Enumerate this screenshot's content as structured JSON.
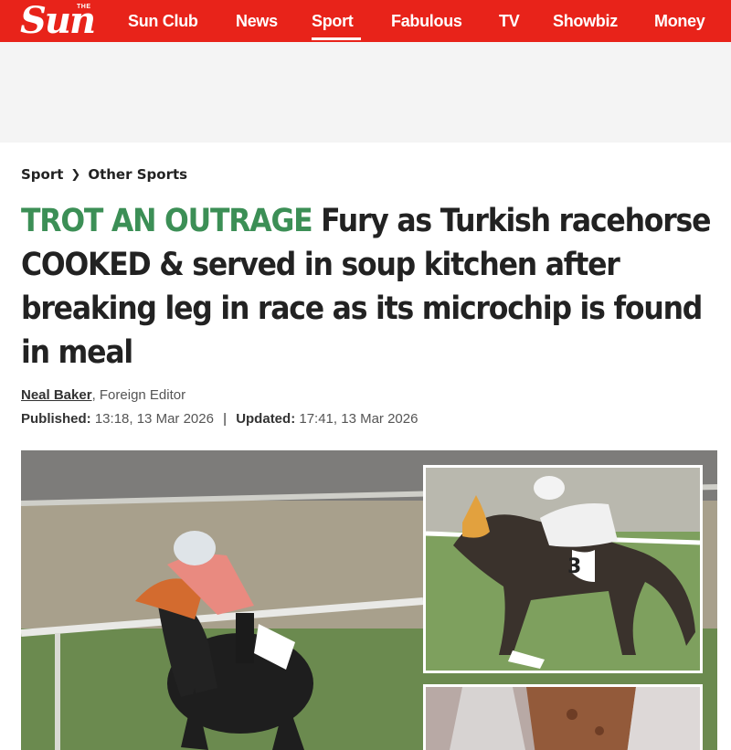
{
  "header": {
    "logo_small": "THE",
    "logo_main": "Sun",
    "nav": [
      {
        "label": "Sun Club",
        "active": false
      },
      {
        "label": "News",
        "active": false
      },
      {
        "label": "Sport",
        "active": true
      },
      {
        "label": "Fabulous",
        "active": false
      },
      {
        "label": "TV",
        "active": false
      },
      {
        "label": "Showbiz",
        "active": false
      },
      {
        "label": "Money",
        "active": false
      }
    ]
  },
  "breadcrumb": {
    "level1": "Sport",
    "level2": "Other Sports"
  },
  "article": {
    "kicker": "TROT AN OUTRAGE",
    "headline": "Fury as Turkish racehorse COOKED & served in soup kitchen after breaking leg in race as its microchip is found in meal",
    "author": "Neal Baker",
    "author_role": ", Foreign Editor",
    "published_label": "Published:",
    "published": "13:18, 13 Mar 2026",
    "updated_label": "Updated:",
    "updated": "17:41, 13 Mar 2026",
    "inset_saddle_number": "3"
  },
  "colors": {
    "brand_red": "#e8231a",
    "kicker_green": "#3c8f56"
  }
}
